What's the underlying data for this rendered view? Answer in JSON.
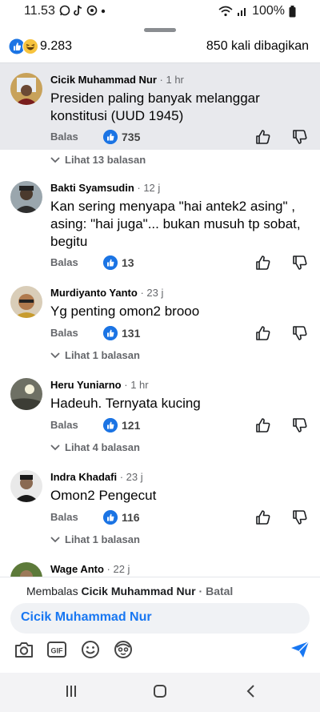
{
  "status_bar": {
    "time": "11.53",
    "battery": "100%"
  },
  "post_stats": {
    "reactions_count": "9.283",
    "shares_text": "850 kali dibagikan"
  },
  "comments": [
    {
      "name": "Cicik Muhammad Nur",
      "time": "· 1 hr",
      "text": "Presiden paling banyak melanggar konstitusi (UUD 1945)",
      "reply_label": "Balas",
      "likes": "735",
      "replies_label": "Lihat 13 balasan"
    },
    {
      "name": "Bakti Syamsudin",
      "time": "· 12 j",
      "text": "Kan sering menyapa \"hai antek2 asing\" , asing: \"hai juga\"... bukan musuh tp sobat, begitu",
      "reply_label": "Balas",
      "likes": "13"
    },
    {
      "name": "Murdiyanto Yanto",
      "time": "· 23 j",
      "text": "Yg penting omon2 brooo",
      "reply_label": "Balas",
      "likes": "131",
      "replies_label": "Lihat 1 balasan"
    },
    {
      "name": "Heru Yuniarno",
      "time": "· 1 hr",
      "text": "Hadeuh. Ternyata kucing",
      "reply_label": "Balas",
      "likes": "121",
      "replies_label": "Lihat 4 balasan"
    },
    {
      "name": "Indra Khadafi",
      "time": "· 23 j",
      "text": "Omon2 Pengecut",
      "reply_label": "Balas",
      "likes": "116",
      "replies_label": "Lihat 1 balasan"
    },
    {
      "name": "Wage Anto",
      "time": "· 22 j"
    }
  ],
  "composer": {
    "replying_prefix": "Membalas",
    "replying_to": "Cicik Muhammad Nur",
    "cancel_label": "Batal",
    "input_value": "Cicik Muhammad Nur"
  },
  "colors": {
    "accent": "#1877f2",
    "like_blue": "#1b74e4",
    "highlight": "#e8e9ed"
  }
}
